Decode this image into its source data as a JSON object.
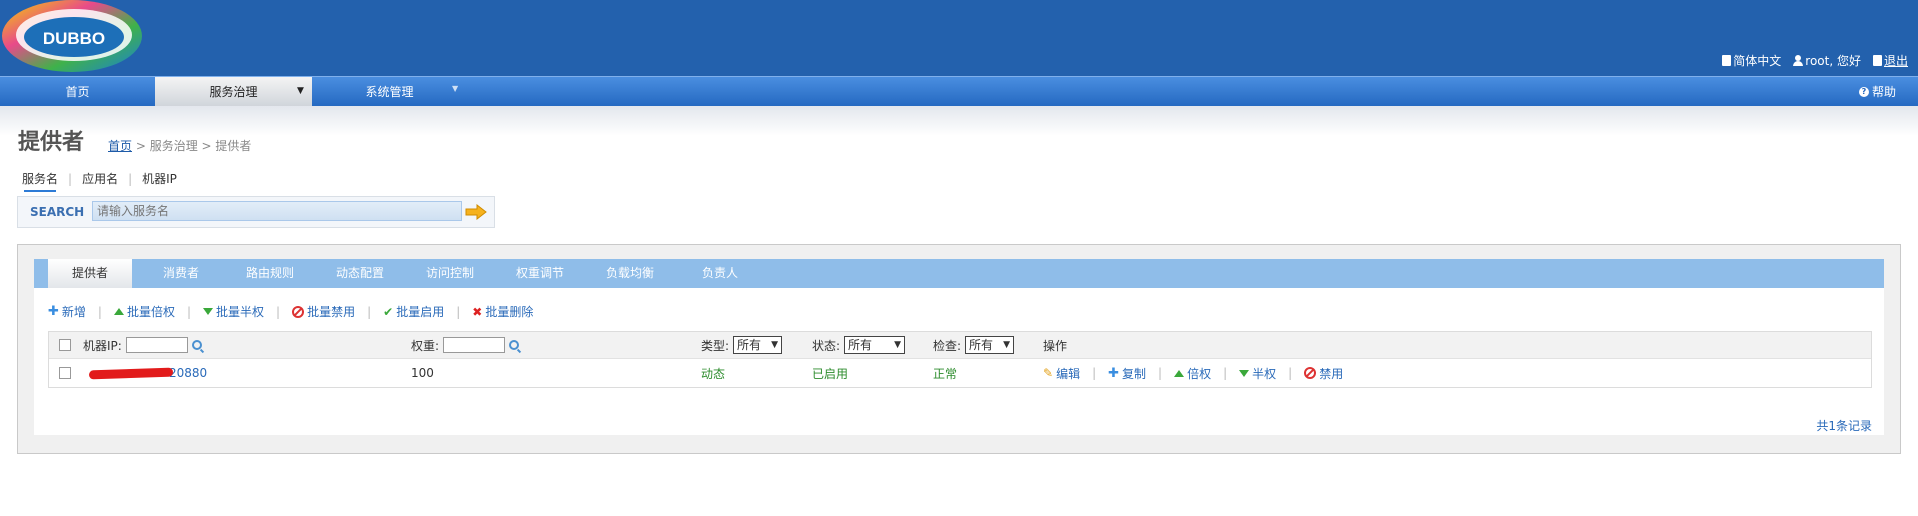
{
  "header": {
    "logo_text": "DUBBO",
    "language": "简体中文",
    "greeting": "root, 您好",
    "logout": "退出"
  },
  "nav": {
    "items": [
      "首页",
      "服务治理",
      "系统管理"
    ],
    "active": "服务治理",
    "help": "帮助"
  },
  "page": {
    "title": "提供者",
    "breadcrumb": {
      "home": "首页",
      "rest": " > 服务治理 > 提供者"
    }
  },
  "search": {
    "tabs": [
      "服务名",
      "应用名",
      "机器IP"
    ],
    "active_tab": "服务名",
    "label": "SEARCH",
    "placeholder": "请输入服务名"
  },
  "tabs": {
    "items": [
      "提供者",
      "消费者",
      "路由规则",
      "动态配置",
      "访问控制",
      "权重调节",
      "负载均衡",
      "负责人"
    ],
    "active": "提供者"
  },
  "toolbar": {
    "add": "新增",
    "batch_double": "批量倍权",
    "batch_half": "批量半权",
    "batch_disable": "批量禁用",
    "batch_enable": "批量启用",
    "batch_delete": "批量删除"
  },
  "table": {
    "headers": {
      "ip": "机器IP:",
      "weight": "权重:",
      "type": "类型:",
      "status": "状态:",
      "check": "检查:",
      "ops": "操作"
    },
    "filters": {
      "type": "所有",
      "status": "所有",
      "check": "所有"
    },
    "rows": [
      {
        "address_suffix": "20880",
        "weight": "100",
        "type": "动态",
        "status": "已启用",
        "check": "正常",
        "ops": {
          "edit": "编辑",
          "copy": "复制",
          "double": "倍权",
          "half": "半权",
          "disable": "禁用"
        }
      }
    ],
    "record_count": "共1条记录"
  },
  "colors": {
    "header_bg": "#2361ad",
    "nav_bg": "#2f74cc",
    "tabbar_bg": "#8fbde9",
    "link": "#2a6ab9",
    "green": "#2d8c2d",
    "danger": "#d22222"
  }
}
